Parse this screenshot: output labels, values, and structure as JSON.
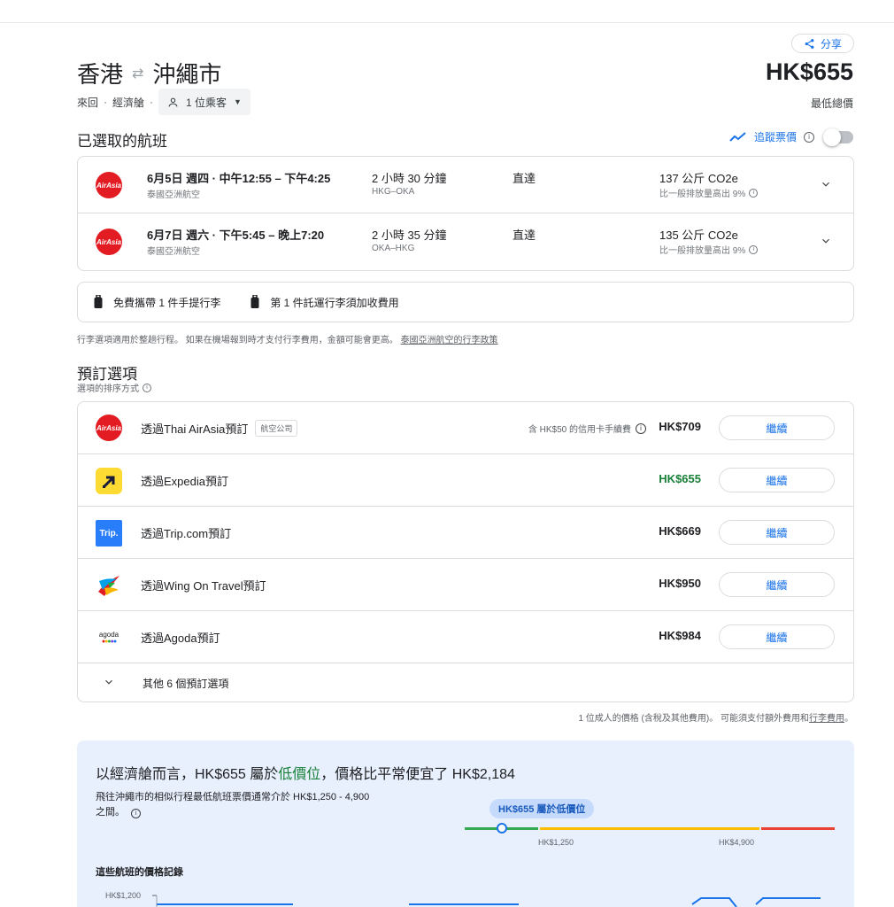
{
  "header": {
    "share_label": "分享",
    "origin": "香港",
    "destination": "沖繩市",
    "trip_type": "來回",
    "cabin": "經濟艙",
    "passengers": "1 位乘客",
    "price": "HK$655",
    "price_note": "最低總價"
  },
  "selected": {
    "title": "已選取的航班",
    "track_label": "追蹤票價",
    "track_enabled": false,
    "flights": [
      {
        "logo": "AirAsia",
        "time": "6月5日 週四 · 中午12:55 – 下午4:25",
        "airline": "泰國亞洲航空",
        "duration": "2 小時 30 分鐘",
        "route": "HKG–OKA",
        "stops": "直達",
        "co2": "137 公斤 CO2e",
        "co2_note": "比一般排放量高出 9%"
      },
      {
        "logo": "AirAsia",
        "time": "6月7日 週六 · 下午5:45 – 晚上7:20",
        "airline": "泰國亞洲航空",
        "duration": "2 小時 35 分鐘",
        "route": "OKA–HKG",
        "stops": "直達",
        "co2": "135 公斤 CO2e",
        "co2_note": "比一般排放量高出 9%"
      }
    ]
  },
  "baggage": {
    "carry_on": "免費攜帶 1 件手提行李",
    "checked": "第 1 件託運行李須加收費用",
    "note": "行李選項適用於整趟行程。 如果在機場報到時才支付行李費用，金額可能會更高。",
    "policy_link": "泰國亞洲航空的行李政策"
  },
  "booking": {
    "title": "預訂選項",
    "subtitle": "選項的排序方式",
    "continue_label": "繼續",
    "options": [
      {
        "name": "透過Thai AirAsia預訂",
        "tag": "航空公司",
        "fee": "含 HK$50 的信用卡手續費",
        "price": "HK$709",
        "logo": "airasia"
      },
      {
        "name": "透過Expedia預訂",
        "price": "HK$655",
        "logo": "expedia"
      },
      {
        "name": "透過Trip.com預訂",
        "price": "HK$669",
        "logo": "trip"
      },
      {
        "name": "透過Wing On Travel預訂",
        "price": "HK$950",
        "logo": "wingon"
      },
      {
        "name": "透過Agoda預訂",
        "price": "HK$984",
        "logo": "agoda"
      }
    ],
    "more_label": "其他 6 個預訂選項",
    "disclaimer": "1 位成人的價格 (含稅及其他費用)。 可能須支付額外費用和",
    "disclaimer_link": "行李費用",
    "disclaimer_end": "。"
  },
  "insights": {
    "headline_pre": "以經濟艙而言，HK$655 屬於",
    "headline_low": "低價位",
    "headline_post": "，價格比平常便宜了 HK$2,184",
    "description": "飛往沖繩市的相似行程最低航班票價通常介於 HK$1,250 - 4,900 之間。",
    "badge": "HK$655 屬於低價位",
    "range_low": "HK$1,250",
    "range_high": "HK$4,900",
    "history_title": "這些航班的價格記錄",
    "history_y_label": "HK$1,200"
  },
  "brand_logos": {
    "airasia_text": "AirAsia",
    "trip_text": "Trip.",
    "agoda_text": "agoda"
  },
  "colors": {
    "accent": "#1a73e8",
    "low": "#188038",
    "airasia": "#e31c23",
    "range_green": "#34a853",
    "range_yellow": "#fbbc04",
    "range_red": "#ea4335"
  }
}
